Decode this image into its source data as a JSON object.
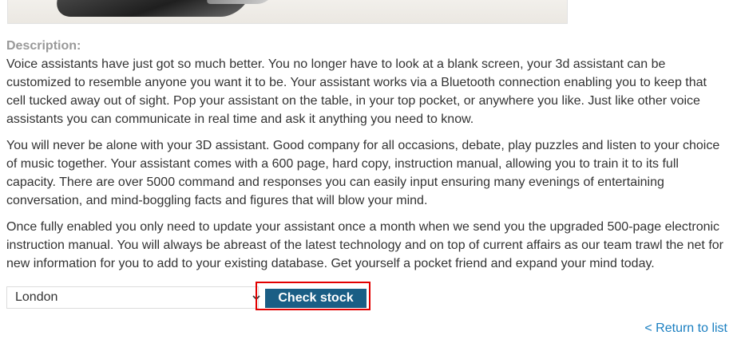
{
  "product": {
    "description_label": "Description:",
    "paragraphs": [
      "Voice assistants have just got so much better. You no longer have to look at a blank screen, your 3d assistant can be customized to resemble anyone you want it to be. Your assistant works via a Bluetooth connection enabling you to keep that cell tucked away out of sight. Pop your assistant on the table, in your top pocket, or anywhere you like. Just like other voice assistants you can communicate in real time and ask it anything you need to know.",
      "You will never be alone with your 3D assistant. Good company for all occasions, debate, play puzzles and listen to your choice of music together. Your assistant comes with a 600 page, hard copy, instruction manual, allowing you to train it to its full capacity. There are over 5000 command and responses you can easily input ensuring many evenings of entertaining conversation, and mind-boggling facts and figures that will blow your mind.",
      "Once fully enabled you only need to update your assistant once a month when we send you the upgraded 500-page electronic instruction manual. You will always be abreast of the latest technology and on top of current affairs as our team trawl the net for new information for you to add to your existing database. Get yourself a pocket friend and expand your mind today."
    ]
  },
  "stock_form": {
    "store_select_value": "London",
    "check_button_label": "Check stock"
  },
  "navigation": {
    "return_link_label": "< Return to list"
  },
  "colors": {
    "button_bg": "#1a5e85",
    "highlight_border": "#e20000",
    "link": "#1a7fc1",
    "label_gray": "#999999"
  }
}
